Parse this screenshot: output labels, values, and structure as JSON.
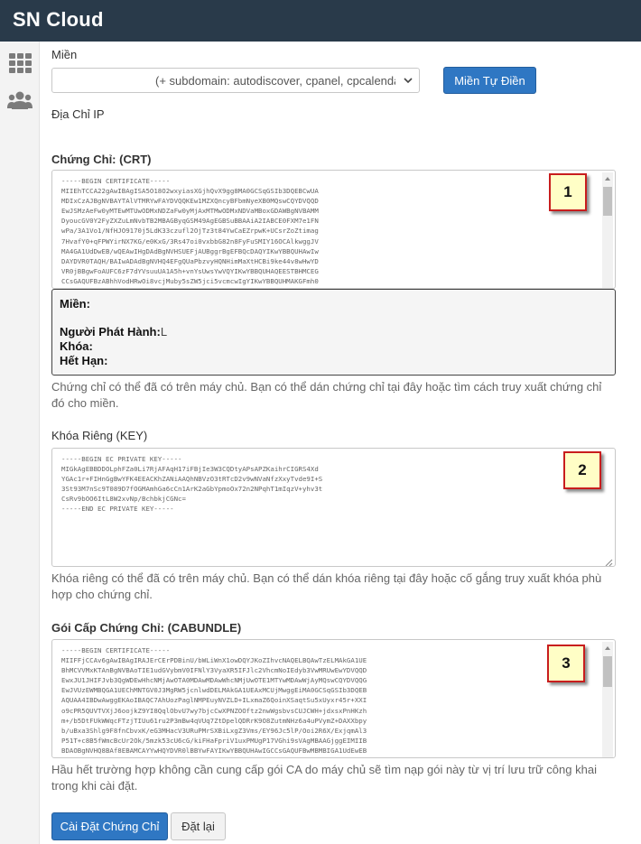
{
  "app": {
    "title": "SN Cloud"
  },
  "sidebar": {
    "items": [
      {
        "icon": "grid-icon"
      },
      {
        "icon": "users-icon"
      }
    ]
  },
  "domain": {
    "label": "Miền",
    "select_value": "(+ subdomain: autodiscover, cpanel, cpcalendars, cpcontacts, mail, webdisk, webmail, www)",
    "autofill_button": "Miền Tự Điền"
  },
  "ip": {
    "label": "Địa Chỉ IP"
  },
  "certificate": {
    "label": "Chứng Chỉ: (CRT)",
    "content": "-----BEGIN CERTIFICATE-----\nMIIEhTCCA22gAwIBAgISA5O18O2wxyiasXGjhQvX9gg8MA0GCSqGSIb3DQEBCwUA\nMDIxCzAJBgNVBAYTAlVTMRYwFAYDVQQKEw1MZXQncyBFbmNyeXB0MQswCQYDVQQD\nEwJSMzAeFw0yMTEwMTUwODMxNDZaFw0yMjAxMTMwODMxNDVaMBoxGDAWBgNVBAMM\nDyoucGV0Y2FyZXZuLmNvbTB2MBAGByqGSM49AgEGBSuBBAAiA2IABCE0FXM7e1FN\nwPa/3A1Vo1/NfHJO9170j5LdK33czufl2OjTz3t84YwCaEZrpwK+UCsrZoZtimag\n7HvafY0+qFPWYirNX7KG/e0KxG/3Rs47oi0vxbbG82n8FyFuSMIY16OCAlkwggJV\nMA4GA1UdDwEB/wQEAwIHgDAdBgNVHSUEFjAUBggrBgEFBQcDAQYIKwYBBQUHAwIw\nDAYDVR0TAQH/BAIwADAdBgNVHQ4EFgQUaPbzvyHQNHimMaXtHCBi9ke44v8wHwYD\nVR0jBBgwFoAUFC6zF7dYVsuuUA1A5h+vnYsUwsYwVQYIKwYBBQUHAQEESTBHMCEG\nCCsGAQUFBzABhhVodHRwOi8vcjMuby5sZW5jci5vcmcwIgYIKwYBBQUHMAKGFmh0"
  },
  "cert_info": {
    "domain_label": "Miền:",
    "issuer_label": "Người Phát Hành:",
    "issuer_value": "L",
    "key_label": "Khóa:",
    "expiry_label": "Hết Hạn:"
  },
  "certificate_help": "Chứng chỉ có thể đã có trên máy chủ. Bạn có thể dán chứng chỉ tại đây hoặc tìm cách truy xuất chứng chỉ đó cho miền.",
  "private_key": {
    "label": "Khóa Riêng (KEY)",
    "content": "-----BEGIN EC PRIVATE KEY-----\nMIGkAgEBBDDOLphFZa0Li7RjAFAqH17iFBjIe3W3CQDtyAPsAPZKaihrCIGRS4Xd\nYGAc1r+FIHnGgBwYFK4EEACKhZANiAAQhNBVzO3tRTcD2v9wNVaNfzXxyTvde9I+S\n3St93M7nSc9T089D7fOGMAmhGa6cCn1ArK2aGbYpmoOx72n2NPqhT1mIqzV+yhv3t\nCsRv9bOO6ItL8W2xvNp/BchbkjCGNc=\n-----END EC PRIVATE KEY-----",
    "help": "Khóa riêng có thể đã có trên máy chủ. Bạn có thể dán khóa riêng tại đây hoặc cố gắng truy xuất khóa phù hợp cho chứng chỉ."
  },
  "cabundle": {
    "label": "Gói Cấp Chứng Chỉ: (CABUNDLE)",
    "content": "-----BEGIN CERTIFICATE-----\nMIIFFjCCAv6gAwIBAgIRAJErCErPDBinU/bWLiWnX1owDQYJKoZIhvcNAQELBQAwTzELMAkGA1UE\nBhMCVVMxKTAnBgNVBAoTIE1udGVybmV0IFNlY3VyaXR5IFJlc2VhcmNoIEdyb3VwMRUwEwYDVQQD\nEwxJU1JHIFJvb3QgWDEwHhcNMjAwOTA0MDAwMDAwWhcNMjUwOTE1MTYwMDAwWjAyMQswCQYDVQQG\nEwJVUzEWMBQGA1UEChMNTGV0J3MgRW5jcnlwdDELMAkGA1UEAxMCUjMwggEiMA0GCSqGSIb3DQEB\nAQUAA4IBDwAwggEKAoIBAQC7AhUozPaglNMPEuyNVZLD+ILxmaZ6QoinXSaqtSu5xUyxr45r+XXI\no9cPR5QUVTVXjJ6oojkZ9YI8QqlObvU7wy7bjcCwXPNZOOftz2nwWgsbvsCUJCWH+jdxsxPnHKzh\nm+/b5DtFUkWWqcFTzjTIUu61ru2P3mBw4qVUq7ZtDpelQDRrK9O8ZutmNHz6a4uPVymZ+DAXXbpy\nb/uBxa3Shlg9F8fnCbvxK/eG3MHacV3URuPMrSXBiLxgZ3Vms/EY96Jc5lP/Ooi2R6X/ExjqmAl3\nP51T+c8B5fWmcBcUr2Ok/5mzk53cU6cG/kiFHaFpriV1uxPMUgP17VGhi9sVAgMBAAGjggEIMIIB\nBDAOBgNVHQ8BAf8EBAMCAYYwHQYDVR0lBBYwFAYIKwYBBQUHAwIGCCsGAQUFBwMBMBIGA1UdEwEB"
  },
  "cabundle_help": "Hầu hết trường hợp không cần cung cấp gói CA do máy chủ sẽ tìm nạp gói này từ vị trí lưu trữ công khai trong khi cài đặt.",
  "callouts": [
    "1",
    "2",
    "3"
  ],
  "actions": {
    "install": "Cài Đặt Chứng Chỉ",
    "reset": "Đặt lại"
  },
  "colors": {
    "topbar": "#293a4a",
    "primary": "#2f77c3",
    "callout_border": "#c81d1d",
    "callout_fill": "#fffec6"
  }
}
